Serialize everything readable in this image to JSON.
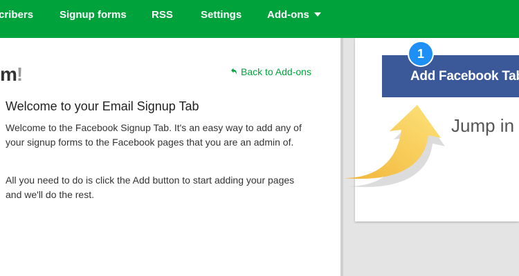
{
  "nav": {
    "items": [
      "cribers",
      "Signup forms",
      "RSS",
      "Settings",
      "Add-ons"
    ]
  },
  "logo_fragment": {
    "text": "m",
    "bang": "!"
  },
  "back_link": "Back to Add-ons",
  "heading": "Welcome to your Email Signup Tab",
  "paragraphs": [
    "Welcome to the Facebook Signup Tab. It's an easy way to add any of your signup forms to the Facebook pages that you are an admin of.",
    "All you need to do is click the Add button to start adding your pages and we'll do the rest."
  ],
  "facebook_button": "Add Facebook Tab",
  "step_badge": "1",
  "jump_text": "Jump in",
  "colors": {
    "brand_green": "#00a33b",
    "facebook_blue": "#3b5998",
    "badge_blue": "#1e90f5",
    "arrow_yellow": "#f5c542"
  }
}
